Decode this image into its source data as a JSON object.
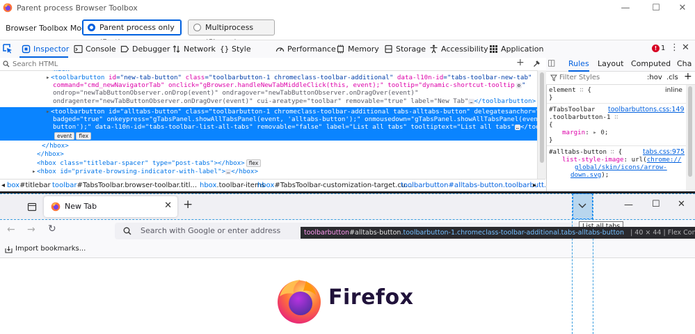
{
  "window": {
    "title": "Parent process Browser Toolbox"
  },
  "mode": {
    "label": "Browser Toolbox Mode",
    "options": [
      {
        "label": "Parent process only",
        "hint": "(Fast)"
      },
      {
        "label": "Multiprocess",
        "hint": "(Slower)"
      }
    ]
  },
  "tabs": [
    "Inspector",
    "Console",
    "Debugger",
    "Network",
    "Style Editor",
    "Performance",
    "Memory",
    "Storage",
    "Accessibility",
    "Application"
  ],
  "error_count": "1",
  "search": {
    "placeholder": "Search HTML"
  },
  "markup": {
    "l1": {
      "a": "<toolbarbutton ",
      "b": "id",
      "c": "=\"new-tab-button\" ",
      "d": "class",
      "e": "=\"toolbarbutton-1 chromeclass-toolbar-additional\" ",
      "f": "data-l10n-id",
      "g": "=\"tabs-toolbar-new-tab\""
    },
    "l2": "command=\"cmd_newNavigatorTab\" onclick=\"gBrowser.handleNewTabMiddleClick(this, event);\" tooltip=\"dynamic-shortcut-tooltip",
    "l3": "ondrop=\"newTabButtonObserver.onDrop(event)\" ondragover=\"newTabButtonObserver.onDragOver(event)\"",
    "l4": "ondragenter=\"newTabButtonObserver.onDragOver(event)\" cui-areatype=\"toolbar\" removable=\"true\" label=\"New Tab\"",
    "l4_end": "</toolbarbutton>",
    "sel1": "<toolbarbutton id=\"alltabs-button\" class=\"toolbarbutton-1 chromeclass-toolbar-additional tabs-alltabs-button\" delegatesanchor=\"true\"",
    "sel2": "badged=\"true\" onkeypress=\"gTabsPanel.showAllTabsPanel(event, 'alltabs-button');\" onmousedown=\"gTabsPanel.showAllTabsPanel(event, 'alltabs-",
    "sel3": "button');\" data-l10n-id=\"tabs-toolbar-list-all-tabs\" removable=\"false\" label=\"List all tabs\" tooltiptext=\"List all tabs\"",
    "sel3_end": "</toolbarbutton>",
    "close_hbox": "</hbox>",
    "close_hbox2": "</hbox>",
    "spacer": "<hbox class=\"titlebar-spacer\" type=\"post-tabs\"></hbox>",
    "pbi": "<hbox id=\"private-browsing-indicator-with-label\">",
    "pbi_end": "</hbox>",
    "badge_event": "event",
    "badge_flex": "flex",
    "ellipsis": "…"
  },
  "breadcrumbs": [
    {
      "prefix": "box",
      "rest": "#titlebar"
    },
    {
      "prefix": "toolbar",
      "rest": "#TabsToolbar.browser-toolbar.titl..."
    },
    {
      "prefix": "hbox",
      "rest": ".toolbar-items"
    },
    {
      "prefix": "hbox",
      "rest": "#TabsToolbar-customization-target.cu..."
    },
    {
      "prefix": "toolbarbutton",
      "rest": "#alltabs-button.toolbarbutt..."
    }
  ],
  "sidebar": {
    "tabs": [
      "Rules",
      "Layout",
      "Computed",
      "Cha"
    ],
    "filter_placeholder": "Filter Styles",
    "hov": ":hov",
    "cls": ".cls",
    "rules": {
      "r1_sel": "element",
      "r1_brace": " {",
      "r1_src": "inline",
      "r1_close": "}",
      "r2_sel1": "#TabsToolbar",
      "r2_sel2": ".toolbarbutton-1",
      "r2_src": "toolbarbuttons.css:149",
      "r2_brace": "{",
      "r2_prop": "margin",
      "r2_val": "0;",
      "r2_close": "}",
      "r3_sel": "#alltabs-button",
      "r3_brace": " {",
      "r3_src": "tabs.css:975",
      "r3_prop": "list-style-image",
      "r3_url1": "chrome://",
      "r3_url2": "global/skin/icons/arrow-",
      "r3_url3": "down.svg",
      "r3_end": ");"
    }
  },
  "browser": {
    "tab_title": "New Tab",
    "url_placeholder": "Search with Google or enter address",
    "bookmarks": "Import bookmarks...",
    "brand": "Firefox",
    "tooltip": "List all tabs"
  },
  "infobar": {
    "tag": "toolbarbutton",
    "id": "#alltabs-button",
    "classes": ".toolbarbutton-1.chromeclass-toolbar-additional.tabs-alltabs-button",
    "dims": "40 × 44",
    "type": "Flex Container/Item"
  },
  "colors": {
    "accent": "#0060df",
    "selection": "#0a84ff",
    "error": "#d70022",
    "infobar_bg": "#2a2a2e"
  }
}
